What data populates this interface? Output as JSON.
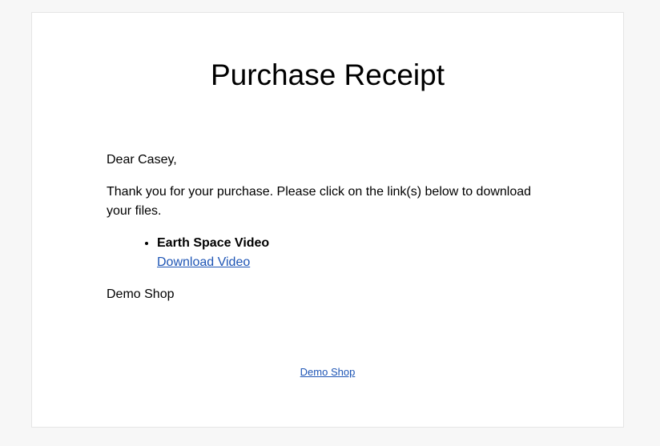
{
  "receipt": {
    "title": "Purchase Receipt",
    "greeting": "Dear Casey,",
    "message": "Thank you for your purchase. Please click on the link(s) below to download your files.",
    "items": [
      {
        "name": "Earth Space Video",
        "link_label": "Download Video"
      }
    ],
    "signature": "Demo Shop"
  },
  "footer": {
    "link_label": "Demo Shop"
  },
  "colors": {
    "background": "#f7f7f7",
    "card": "#ffffff",
    "link": "#1e55b5"
  }
}
